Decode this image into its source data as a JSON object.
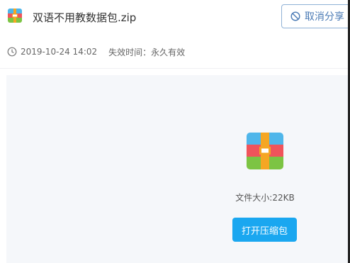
{
  "file": {
    "name": "双语不用教数据包.zip",
    "icon": "zip-archive-icon",
    "date": "2019-10-24 14:02",
    "expire_text": "失效时间：永久有效",
    "size_text": "文件大小:22KB"
  },
  "actions": {
    "cancel_share_label": "取消分享",
    "open_archive_label": "打开压缩包"
  },
  "colors": {
    "accent_blue": "#1aa7f0",
    "cancel_border": "#8fb1d6",
    "cancel_text": "#4a7ab5",
    "panel_bg": "#f5f7fa",
    "zip_top": "#4fb6ea",
    "zip_middle": "#f0545b",
    "zip_bottom": "#7cc443",
    "zip_strap": "#f5a623"
  }
}
